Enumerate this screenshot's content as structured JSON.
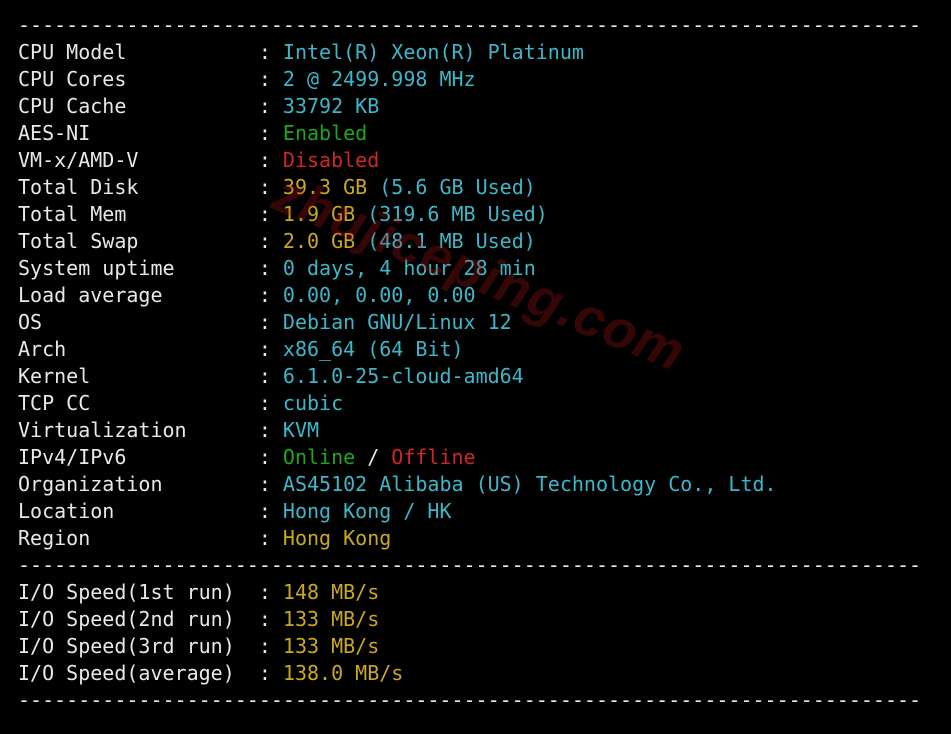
{
  "hr_top": "---------------------------------------------------------------------------",
  "hr_mid": "---------------------------------------------------------------------------",
  "hr_bot": "---------------------------------------------------------------------------",
  "sys": {
    "cpu_model": {
      "label": "CPU Model          ",
      "sep": " : ",
      "value": "Intel(R) Xeon(R) Platinum"
    },
    "cpu_cores": {
      "label": "CPU Cores          ",
      "sep": " : ",
      "value": "2 @ 2499.998 MHz"
    },
    "cpu_cache": {
      "label": "CPU Cache          ",
      "sep": " : ",
      "value": "33792 KB"
    },
    "aes_ni": {
      "label": "AES-NI             ",
      "sep": " : ",
      "value": "Enabled"
    },
    "vmx": {
      "label": "VM-x/AMD-V         ",
      "sep": " : ",
      "value": "Disabled"
    },
    "total_disk": {
      "label": "Total Disk         ",
      "sep": " : ",
      "size": "39.3 GB",
      "used": " (5.6 GB Used)"
    },
    "total_mem": {
      "label": "Total Mem          ",
      "sep": " : ",
      "size": "1.9 GB",
      "used": " (319.6 MB Used)"
    },
    "total_swap": {
      "label": "Total Swap         ",
      "sep": " : ",
      "size": "2.0 GB",
      "used": " (48.1 MB Used)"
    },
    "uptime": {
      "label": "System uptime      ",
      "sep": " : ",
      "value": "0 days, 4 hour 28 min"
    },
    "load": {
      "label": "Load average       ",
      "sep": " : ",
      "value": "0.00, 0.00, 0.00"
    },
    "os": {
      "label": "OS                 ",
      "sep": " : ",
      "value": "Debian GNU/Linux 12"
    },
    "arch": {
      "label": "Arch               ",
      "sep": " : ",
      "value": "x86_64 (64 Bit)"
    },
    "kernel": {
      "label": "Kernel             ",
      "sep": " : ",
      "value": "6.1.0-25-cloud-amd64"
    },
    "tcp_cc": {
      "label": "TCP CC             ",
      "sep": " : ",
      "value": "cubic"
    },
    "virt": {
      "label": "Virtualization     ",
      "sep": " : ",
      "value": "KVM"
    },
    "ipstack": {
      "label": "IPv4/IPv6          ",
      "sep": " : ",
      "v4": "Online",
      "slash": " / ",
      "v6": "Offline"
    },
    "org": {
      "label": "Organization       ",
      "sep": " : ",
      "value": "AS45102 Alibaba (US) Technology Co., Ltd."
    },
    "location": {
      "label": "Location           ",
      "sep": " : ",
      "value": "Hong Kong / HK"
    },
    "region": {
      "label": "Region             ",
      "sep": " : ",
      "value": "Hong Kong"
    }
  },
  "io": {
    "run1": {
      "label": "I/O Speed(1st run) ",
      "sep": " : ",
      "value": "148 MB/s"
    },
    "run2": {
      "label": "I/O Speed(2nd run) ",
      "sep": " : ",
      "value": "133 MB/s"
    },
    "run3": {
      "label": "I/O Speed(3rd run) ",
      "sep": " : ",
      "value": "133 MB/s"
    },
    "avg": {
      "label": "I/O Speed(average) ",
      "sep": " : ",
      "value": "138.0 MB/s"
    }
  },
  "watermark": "zhujiceping.com"
}
